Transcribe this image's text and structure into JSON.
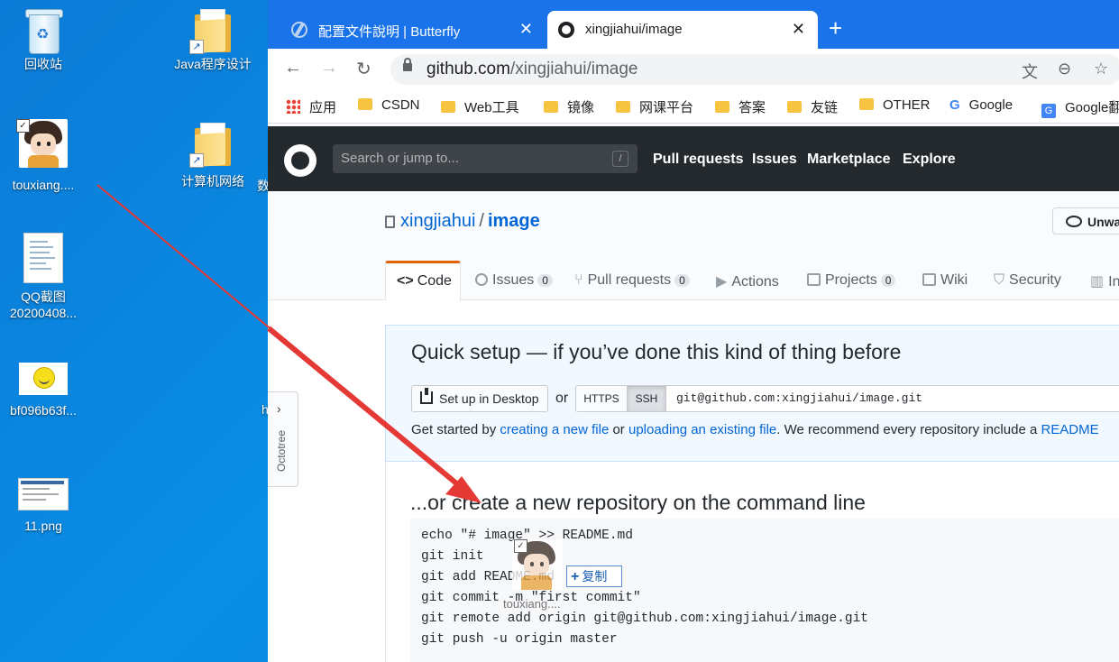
{
  "desktop": {
    "icons": [
      {
        "label": "回收站"
      },
      {
        "label": "Java程序设计"
      },
      {
        "label": "touxiang...."
      },
      {
        "label": "计算机网络"
      },
      {
        "label": "QQ截图"
      },
      {
        "label": "20200408..."
      },
      {
        "label": "bf096b63f..."
      },
      {
        "label": "11.png"
      }
    ],
    "cut_labels": [
      "数",
      "h"
    ]
  },
  "browser": {
    "tabs": [
      {
        "title": "配置文件說明 | Butterfly",
        "close": "✕"
      },
      {
        "title": "xingjiahui/image",
        "close": "✕"
      }
    ],
    "new_tab": "+",
    "url_host": "github.com",
    "url_path": "/xingjiahui/image",
    "bookmarks": [
      "应用",
      "CSDN",
      "Web工具",
      "镜像",
      "网课平台",
      "答案",
      "友链",
      "OTHER",
      "Google",
      "Google翻"
    ]
  },
  "github": {
    "search_placeholder": "Search or jump to...",
    "search_key": "/",
    "nav": [
      "Pull requests",
      "Issues",
      "Marketplace",
      "Explore"
    ],
    "owner": "xingjiahui",
    "slash": "/",
    "repo": "image",
    "watch_label": "Unwat",
    "tabs": [
      {
        "label": "Code"
      },
      {
        "label": "Issues",
        "count": "0"
      },
      {
        "label": "Pull requests",
        "count": "0"
      },
      {
        "label": "Actions"
      },
      {
        "label": "Projects",
        "count": "0"
      },
      {
        "label": "Wiki"
      },
      {
        "label": "Security"
      },
      {
        "label": "In"
      }
    ],
    "quick_setup": {
      "title": "Quick setup — if you’ve done this kind of thing before",
      "desktop_btn": "Set up in Desktop",
      "or": "or",
      "https": "HTTPS",
      "ssh": "SSH",
      "clone_url": "git@github.com:xingjiahui/image.git",
      "hint_1": "Get started by ",
      "hint_link1": "creating a new file",
      "hint_2": " or ",
      "hint_link2": "uploading an existing file",
      "hint_3": ". We recommend every repository include a ",
      "hint_link3": "README"
    },
    "cmdline": {
      "title": "...or create a new repository on the command line",
      "lines": [
        "echo \"# image\" >> README.md",
        "git init",
        "git add README.md",
        "git commit -m \"first commit\"",
        "git remote add origin git@github.com:xingjiahui/image.git",
        "git push -u origin master"
      ]
    }
  },
  "octotree": {
    "label": "Octotree",
    "chevron": "›"
  },
  "drag": {
    "label": "touxiang....",
    "copy_label": "复制",
    "plus": "+"
  },
  "colors": {
    "accent": "#1a73e8",
    "gh_header": "#24292e",
    "link": "#0366d6",
    "arrow": "#e53935",
    "tab_active": "#e36209"
  }
}
